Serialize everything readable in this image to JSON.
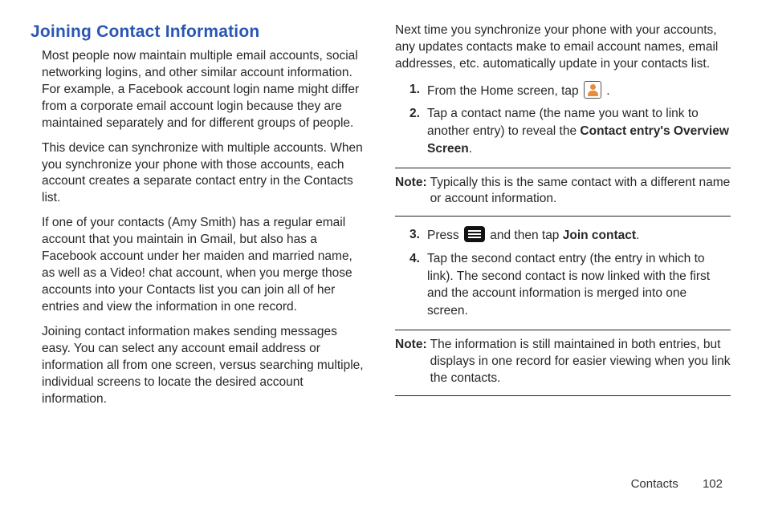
{
  "heading": "Joining Contact Information",
  "left_paragraphs": [
    "Most people now maintain multiple email accounts, social networking logins, and other similar account information. For example, a Facebook account login name might differ from a corporate email account login because they are maintained separately and for different groups of people.",
    "This device can synchronize with multiple accounts. When you synchronize your phone with those accounts, each account creates a separate contact entry in the Contacts list.",
    "If one of your contacts (Amy Smith) has a regular email account that you maintain in Gmail, but also has a Facebook account under her maiden and married name, as well as a Video! chat account, when you merge those accounts into your Contacts list you can join all of her entries and view the information in one record.",
    "Joining contact information makes sending messages easy. You can select any account email address or information all from one screen, versus searching multiple, individual screens to locate the desired account information."
  ],
  "right_intro": "Next time you synchronize your phone with your accounts, any updates contacts make to email account names, email addresses, etc. automatically update in your contacts list.",
  "steps_a": [
    {
      "num": "1.",
      "pre": "From the Home screen, tap ",
      "post": " ."
    },
    {
      "num": "2.",
      "pre": "Tap a contact name (the name you want to link to another entry) to reveal the ",
      "bold": "Contact entry's Overview Screen",
      "post": "."
    }
  ],
  "note1": {
    "label": "Note:",
    "text": "Typically this is the same contact with a different name or account information."
  },
  "steps_b": [
    {
      "num": "3.",
      "pre": "Press ",
      "mid": " and then tap ",
      "bold": "Join contact",
      "post": "."
    },
    {
      "num": "4.",
      "text": "Tap the second contact entry (the entry in which to link). The second contact is now linked with the first and the account information is merged into one screen."
    }
  ],
  "note2": {
    "label": "Note:",
    "text": "The information is still maintained in both entries, but displays in one record for easier viewing when you link the contacts."
  },
  "footer": {
    "section": "Contacts",
    "page": "102"
  }
}
